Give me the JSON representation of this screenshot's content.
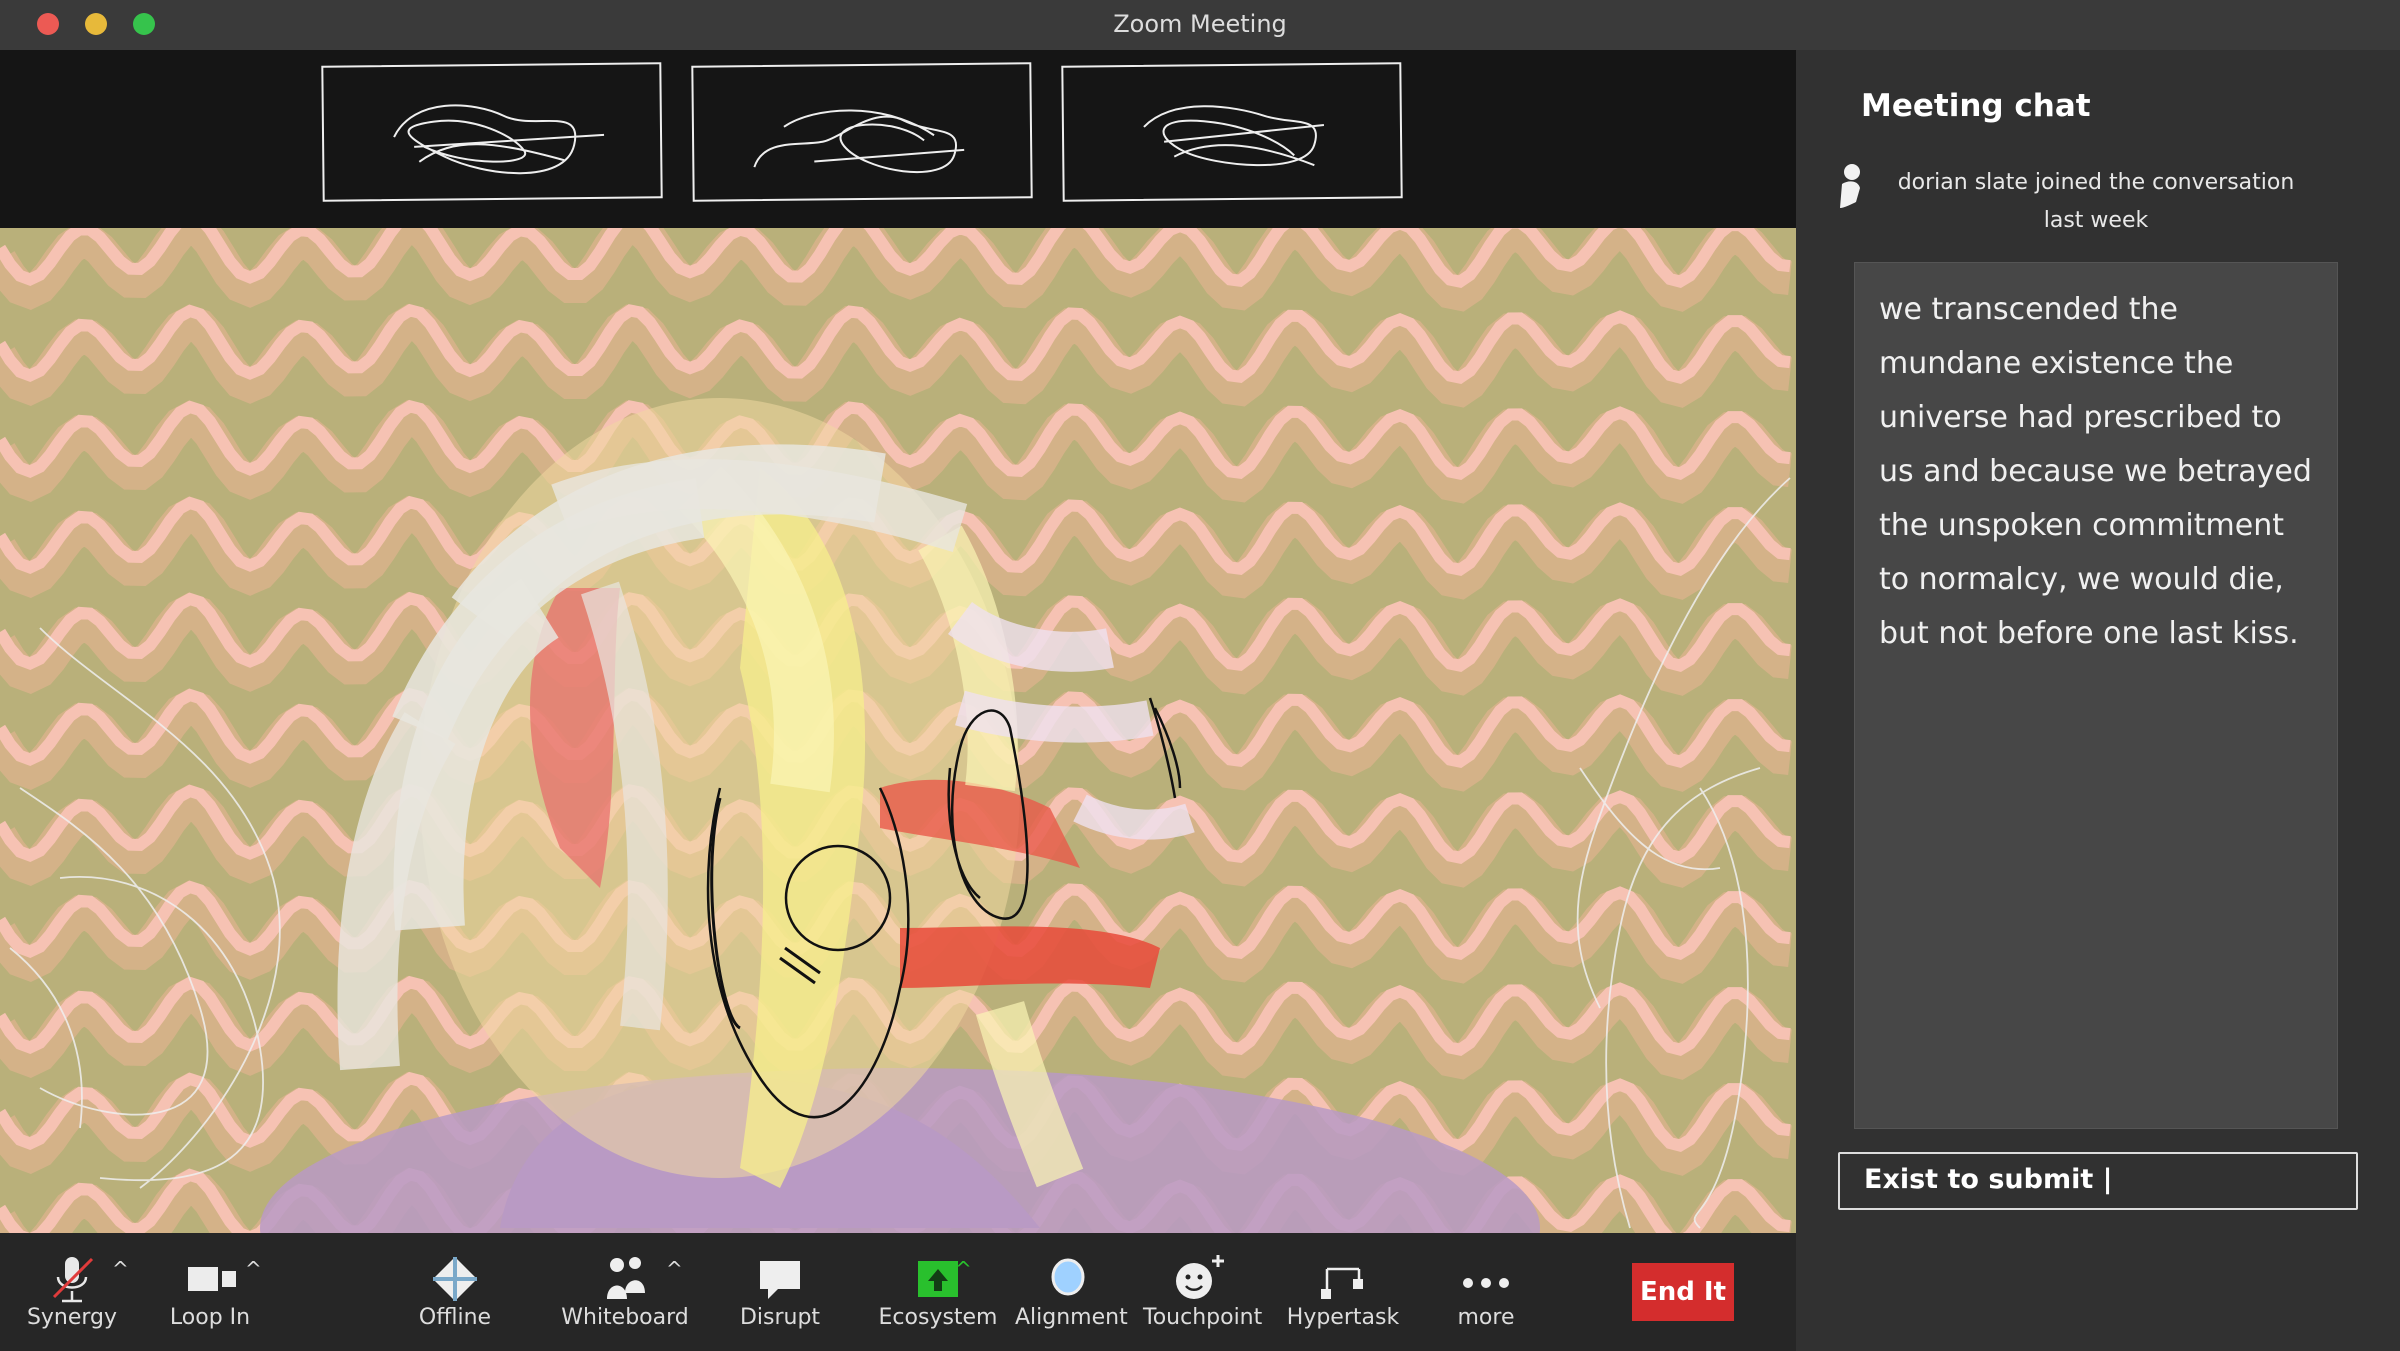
{
  "window": {
    "title": "Zoom Meeting",
    "traffic_lights": [
      "#ec5a54",
      "#e7b93a",
      "#36c34c"
    ]
  },
  "thumbnails": [
    {
      "name": "participant-1"
    },
    {
      "name": "participant-2"
    },
    {
      "name": "participant-3"
    }
  ],
  "chat": {
    "title": "Meeting chat",
    "joined_text": "dorian slate joined the conversation last week",
    "message": "we transcended the mundane existence the universe had prescribed to us and because we betrayed the unspoken commitment to normalcy, we would die, but not before one last kiss.",
    "input_placeholder": "Exist to submit |"
  },
  "toolbar": {
    "items": [
      {
        "label": "Synergy",
        "icon": "muted-microphone-icon"
      },
      {
        "label": "Loop In",
        "icon": "video-camera-icon"
      },
      {
        "label": "Offline",
        "icon": "diamond-icon"
      },
      {
        "label": "Whiteboard",
        "icon": "people-icon"
      },
      {
        "label": "Disrupt",
        "icon": "speech-bubble-icon"
      },
      {
        "label": "Ecosystem",
        "icon": "share-screen-icon"
      },
      {
        "label": "Alignment",
        "icon": "bubble-icon"
      },
      {
        "label": "Touchpoint",
        "icon": "smiley-plus-icon"
      },
      {
        "label": "Hypertask",
        "icon": "hypertask-icon"
      },
      {
        "label": "more",
        "icon": "more-dots-icon"
      }
    ],
    "end_label": "End It",
    "end_color": "#d42d2d"
  },
  "colors": {
    "video_bg": "#b9b07a",
    "wave_pink": "#f6c2b3",
    "wave_tan": "#d7b28a"
  }
}
